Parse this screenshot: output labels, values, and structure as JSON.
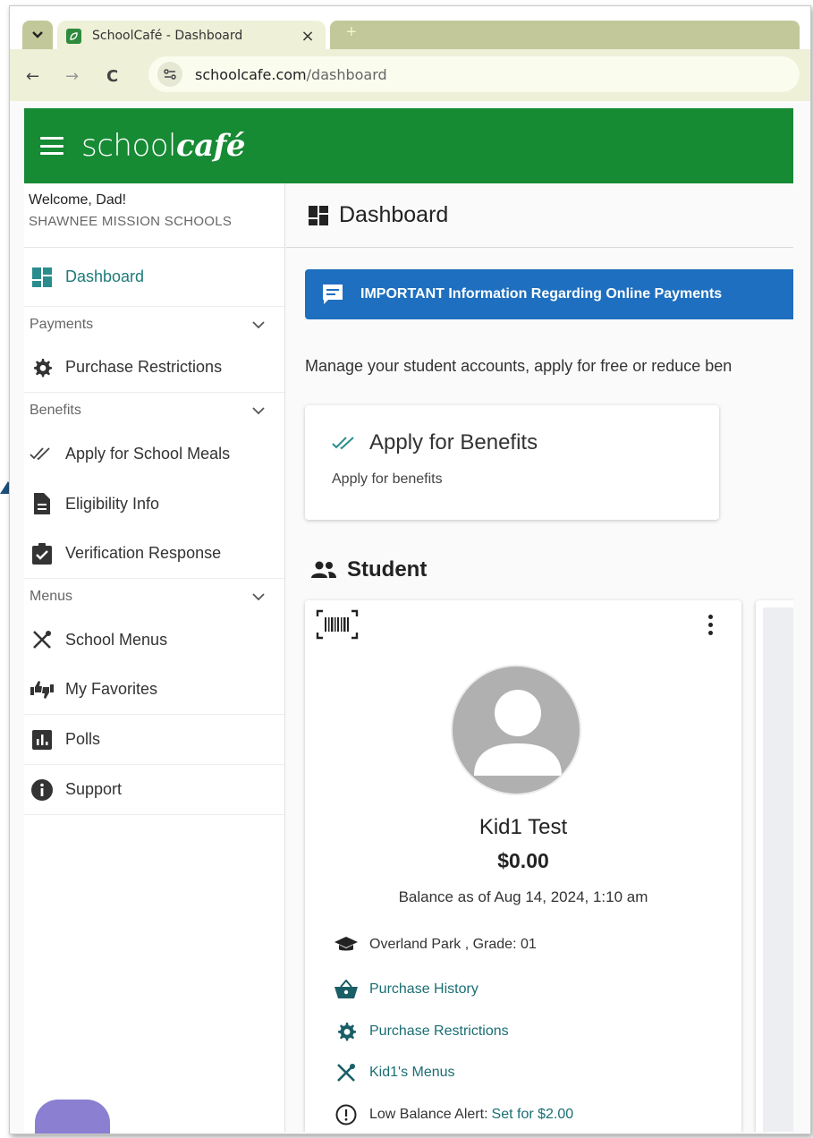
{
  "browser": {
    "tab_title": "SchoolCafé - Dashboard",
    "tab_close": "×",
    "new_tab": "+",
    "url_host": "schoolcafe.com",
    "url_path": "/dashboard",
    "back": "←",
    "forward": "→",
    "reload": "C"
  },
  "app": {
    "logo_school": "school",
    "logo_cafe": "café",
    "brand_color": "#178a34"
  },
  "sidebar": {
    "welcome": "Welcome, Dad!",
    "district": "SHAWNEE MISSION SCHOOLS",
    "dashboard": "Dashboard",
    "sections": {
      "payments": "Payments",
      "benefits": "Benefits",
      "menus": "Menus"
    },
    "items": {
      "purchase_restrictions": "Purchase Restrictions",
      "apply_school_meals": "Apply for School Meals",
      "eligibility_info": "Eligibility Info",
      "verification_response": "Verification Response",
      "school_menus": "School Menus",
      "my_favorites": "My Favorites",
      "polls": "Polls",
      "support": "Support"
    }
  },
  "main": {
    "page_title": "Dashboard",
    "banner": "IMPORTANT Information Regarding Online Payments",
    "intro": "Manage your student accounts, apply for free or reduce ben",
    "benefits_card": {
      "title": "Apply for Benefits",
      "subtitle": "Apply for benefits"
    },
    "student_heading": "Student",
    "student": {
      "name": "Kid1 Test",
      "balance": "$0.00",
      "balance_date": "Balance as of Aug 14, 2024, 1:10 am",
      "school": "Overland Park , Grade: 01",
      "purchase_history": "Purchase History",
      "purchase_restrictions": "Purchase Restrictions",
      "menus": "Kid1's Menus",
      "low_balance_label": "Low Balance Alert:",
      "low_balance_value": "Set for $2.00"
    }
  }
}
